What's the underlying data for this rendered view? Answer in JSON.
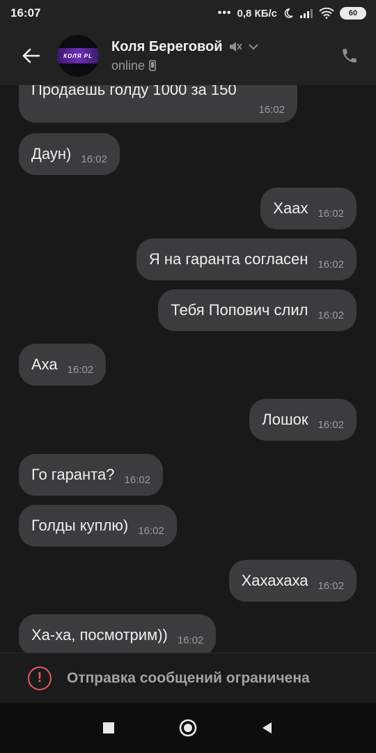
{
  "statusbar": {
    "time": "16:07",
    "dots": "•••",
    "speed": "0,8 КБ/с",
    "battery": "60"
  },
  "header": {
    "name": "Коля Береговой",
    "status": "online",
    "avatar_text": "КОЛЯ PL"
  },
  "messages": [
    {
      "side": "in",
      "text": "Продаешь голду 1000 за 150",
      "time": "16:02"
    },
    {
      "side": "in",
      "text": "Даун)",
      "time": "16:02"
    },
    {
      "side": "out",
      "text": "Хаах",
      "time": "16:02"
    },
    {
      "side": "out",
      "text": "Я на гаранта согласен",
      "time": "16:02"
    },
    {
      "side": "out",
      "text": "Тебя Попович слил",
      "time": "16:02"
    },
    {
      "side": "in",
      "text": "Аха",
      "time": "16:02"
    },
    {
      "side": "out",
      "text": "Лошок",
      "time": "16:02"
    },
    {
      "side": "in",
      "text": "Го гаранта?",
      "time": "16:02"
    },
    {
      "side": "in",
      "text": "Голды куплю)",
      "time": "16:02"
    },
    {
      "side": "out",
      "text": "Хахахаха",
      "time": "16:02"
    },
    {
      "side": "in",
      "text": "Ха-ха, посмотрим))",
      "time": "16:02"
    }
  ],
  "restricted": {
    "icon": "warning-icon",
    "text": "Отправка сообщений ограничена"
  },
  "navbar": {
    "items": [
      "recents-icon",
      "home-icon",
      "back-icon"
    ]
  }
}
